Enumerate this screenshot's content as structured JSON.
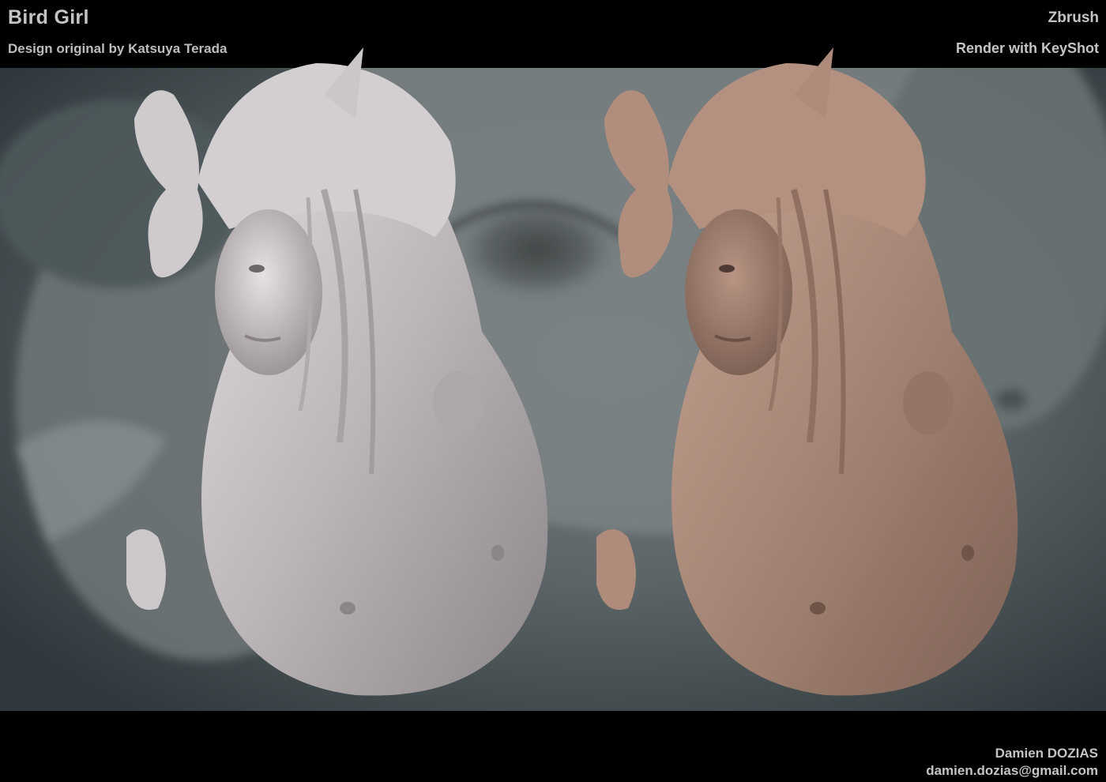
{
  "header": {
    "title": "Bird Girl",
    "subtitle": "Design original by Katsuya Terada",
    "software": "Zbrush",
    "renderer": "Render with KeyShot"
  },
  "footer": {
    "artist_name": "Damien DOZIAS",
    "artist_email": "damien.dozias@gmail.com"
  },
  "colors": {
    "bars": "#000000",
    "backdrop": "#4a5558",
    "clay_grey": "#c9c3c3",
    "clay_terracotta": "#a58474",
    "text": "#c4c4c4"
  }
}
